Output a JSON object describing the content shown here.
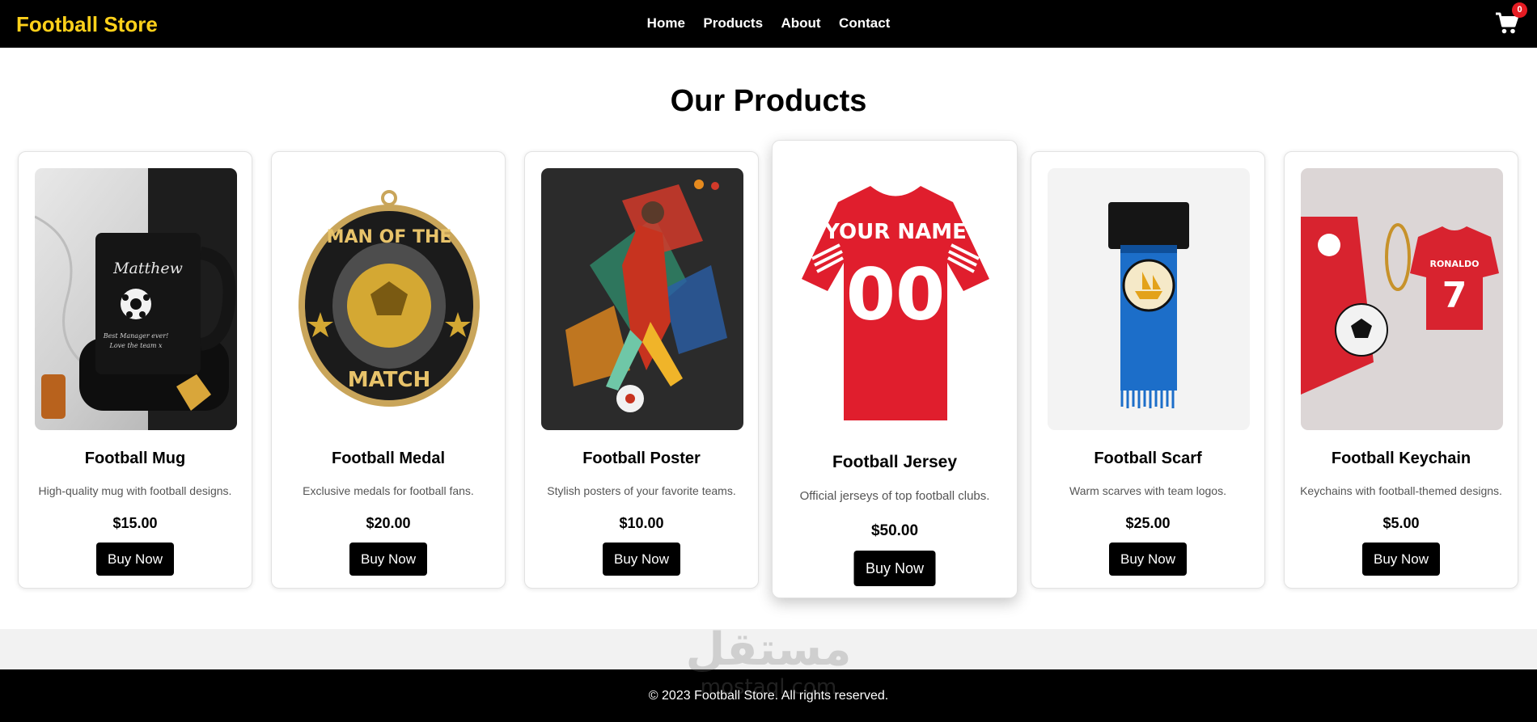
{
  "header": {
    "brand": "Football Store",
    "nav": [
      "Home",
      "Products",
      "About",
      "Contact"
    ],
    "cart_count": "0",
    "cart_icon": "cart-icon",
    "accent": "#ffd11a"
  },
  "main": {
    "title": "Our Products"
  },
  "products": [
    {
      "name": "Football Mug",
      "desc": "High-quality mug with football designs.",
      "price": "$15.00",
      "button": "Buy Now",
      "image_text": "Matthew",
      "image_subtext": "Best Manager ever! Love the team x"
    },
    {
      "name": "Football Medal",
      "desc": "Exclusive medals for football fans.",
      "price": "$20.00",
      "button": "Buy Now",
      "image_text": "MAN OF THE",
      "image_subtext": "MATCH"
    },
    {
      "name": "Football Poster",
      "desc": "Stylish posters of your favorite teams.",
      "price": "$10.00",
      "button": "Buy Now"
    },
    {
      "name": "Football Jersey",
      "desc": "Official jerseys of top football clubs.",
      "price": "$50.00",
      "button": "Buy Now",
      "image_text": "YOUR NAME",
      "image_subtext": "00"
    },
    {
      "name": "Football Scarf",
      "desc": "Warm scarves with team logos.",
      "price": "$25.00",
      "button": "Buy Now"
    },
    {
      "name": "Football Keychain",
      "desc": "Keychains with football-themed designs.",
      "price": "$5.00",
      "button": "Buy Now",
      "image_text": "RONALDO",
      "image_subtext": "7"
    }
  ],
  "footer": {
    "text": "© 2023 Football Store. All rights reserved."
  },
  "watermark": {
    "text": "مستقل",
    "subtext": "mostaql.com"
  }
}
